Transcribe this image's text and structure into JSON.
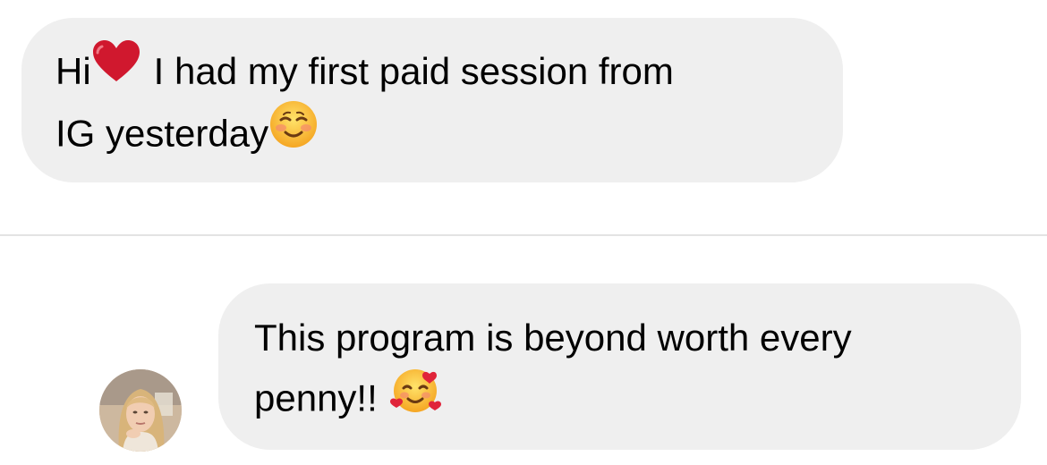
{
  "messages": [
    {
      "sender": "other",
      "lines": [
        "Hi",
        "I had my first paid session from",
        "IG yesterday"
      ],
      "emojis": [
        "red-heart",
        "smiling-face-with-blush"
      ]
    },
    {
      "sender": "self",
      "lines": [
        "This program is beyond worth every",
        "penny!!"
      ],
      "emojis": [
        "smiling-face-with-hearts"
      ]
    }
  ],
  "colors": {
    "bubble": "#efefef",
    "divider": "#e3e3e3",
    "heart": "#d0182e"
  }
}
